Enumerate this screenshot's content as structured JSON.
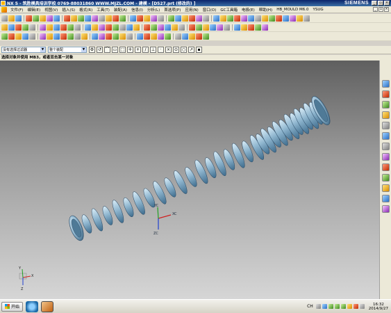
{
  "titlebar": {
    "title": "NX 5 - 筑胜模具培训学校   0769-88031860   WWW.MJZL.COM - 建模 - [D527.prt  (修改的)  ]",
    "brand": "SIEMENS"
  },
  "menubar": {
    "items": [
      "文件(F)",
      "编辑(E)",
      "视图(V)",
      "插入(S)",
      "格式(R)",
      "工具(T)",
      "装配(A)",
      "信息(I)",
      "分析(L)",
      "首选项(P)",
      "应用(N)",
      "窗口(O)",
      "GC工具箱",
      "电极(E)",
      "帮助(H)",
      "HB_MOULD M6.0",
      "YSUG"
    ]
  },
  "selection_bar": {
    "filter_value": "没有选择过滤器",
    "assembly_value": "整个装配"
  },
  "status_line": "选择对象并使用 MB3，或者双击某一对象",
  "viewport": {
    "triad_labels": {
      "xc": "XC",
      "yc": "YC",
      "zc": "ZC"
    },
    "absolute_triad_labels": {
      "x": "X",
      "y": "Y",
      "z": "Z"
    }
  },
  "taskbar": {
    "start_label": "开始",
    "tray_lang": "CH",
    "clock_time": "16:32",
    "clock_date": "2014/9/27"
  },
  "colors": {
    "part_face": "#8fb6cf",
    "part_highlight": "#d8ecf7",
    "part_edge": "#2a4a66"
  }
}
